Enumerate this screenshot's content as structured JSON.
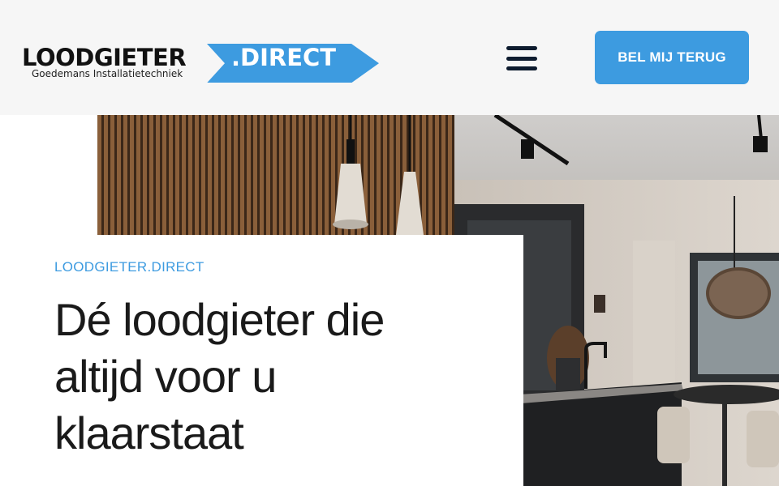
{
  "header": {
    "logo": {
      "brand": "LOODGIETER",
      "domain": ".DIRECT",
      "tagline": "Goedemans Installatietechniek"
    },
    "menu_icon": "hamburger-menu-icon",
    "cta_label": "BEL MIJ TERUG"
  },
  "hero": {
    "eyebrow": "LOODGIETER.DIRECT",
    "headline": "Dé loodgieter die altijd voor u klaarstaat"
  },
  "colors": {
    "accent": "#3d9be0",
    "header_bg": "#f6f6f6",
    "text_dark": "#1a1a1a",
    "menu_icon": "#0d1b2e"
  }
}
